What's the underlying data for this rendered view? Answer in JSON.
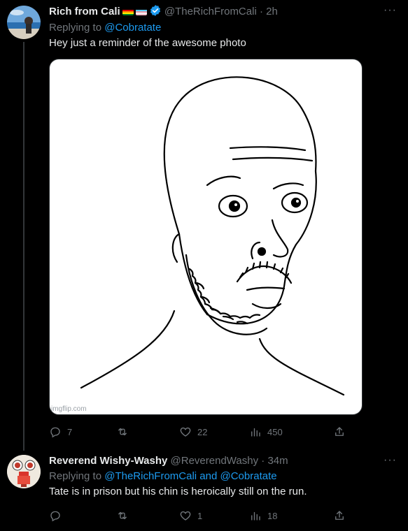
{
  "tweets": [
    {
      "name": "Rich from Cali",
      "handle": "@TheRichFromCali",
      "dot": "·",
      "time": "2h",
      "replying_prefix": "Replying to ",
      "replying_to": "@Cobratate",
      "text": "Hey just a reminder of the awesome photo",
      "media": {
        "watermark": "imgflip.com"
      },
      "counts": {
        "replies": "7",
        "retweets": "",
        "likes": "22",
        "views": "450"
      }
    },
    {
      "name": "Reverend Wishy-Washy",
      "handle": "@ReverendWashy",
      "dot": "·",
      "time": "34m",
      "replying_prefix": "Replying to ",
      "replying_to": "@TheRichFromCali and @Cobratate",
      "text": "Tate is in prison but his chin is heroically still on the run.",
      "counts": {
        "replies": "",
        "retweets": "",
        "likes": "1",
        "views": "18"
      }
    }
  ],
  "more_label": "···",
  "colors": {
    "background": "#000000",
    "text": "#e7e9ea",
    "muted": "#71767b",
    "link": "#1d9bf0",
    "verified": "#1d9bf0"
  }
}
